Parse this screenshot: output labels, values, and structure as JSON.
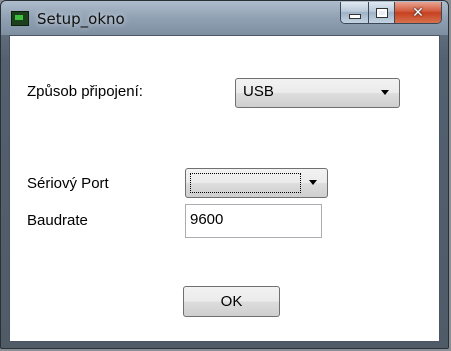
{
  "window": {
    "title": "Setup_okno",
    "icon": "app-icon",
    "controls": {
      "minimize": "minimize-icon",
      "maximize": "maximize-icon",
      "close": "close-icon"
    }
  },
  "form": {
    "connection_label": "Způsob připojení:",
    "connection_value": "USB",
    "serial_port_label": "Sériový Port",
    "serial_port_value": "",
    "baudrate_label": "Baudrate",
    "baudrate_value": "9600",
    "ok_label": "OK"
  },
  "colors": {
    "close_button": "#c7401f",
    "client_background": "#ffffff",
    "frame": "#53606f"
  }
}
